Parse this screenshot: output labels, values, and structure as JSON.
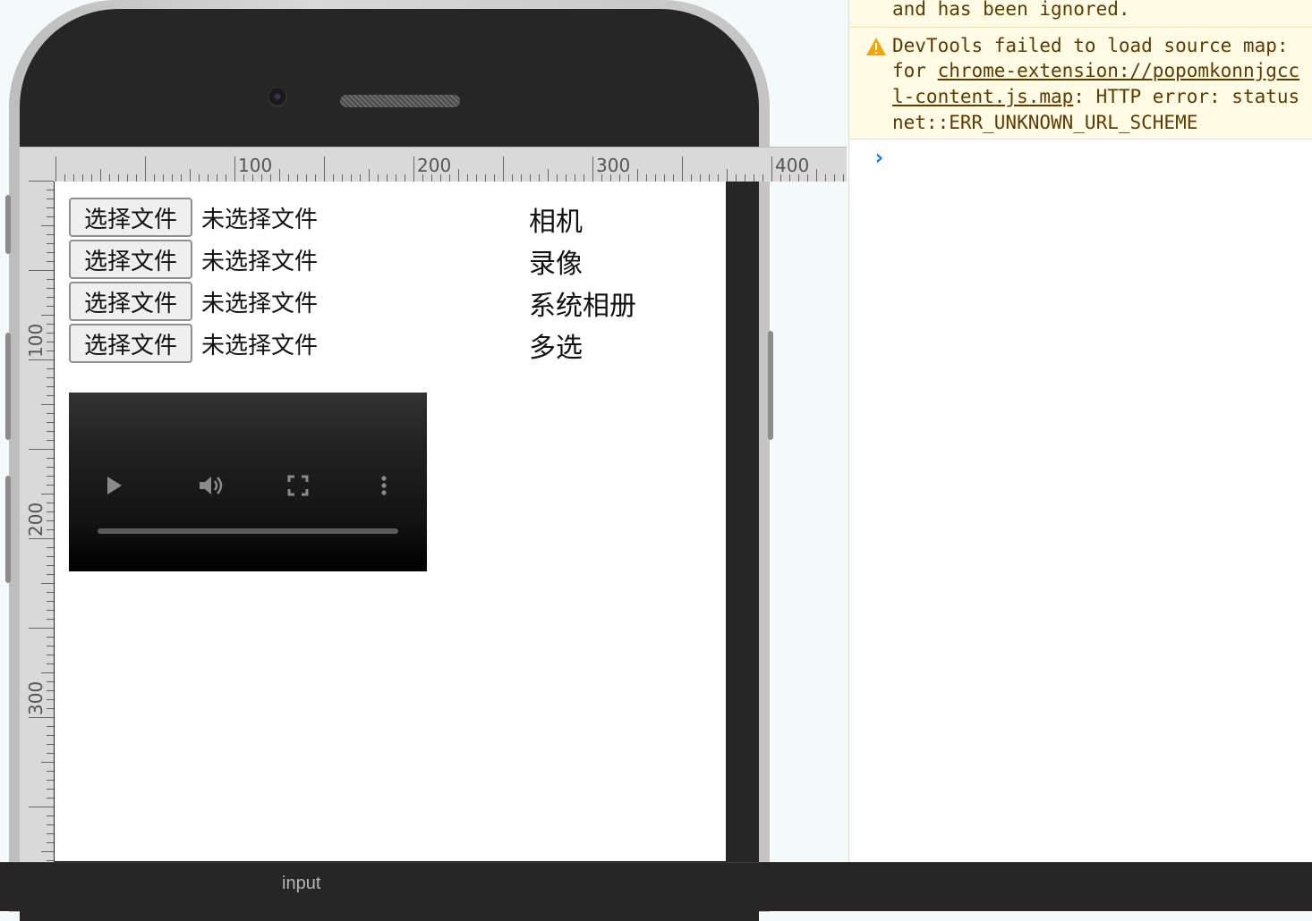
{
  "rulers": {
    "top_labels": [
      "100",
      "200",
      "300",
      "400"
    ],
    "left_labels": [
      "100",
      "200",
      "300"
    ]
  },
  "viewport": {
    "file_inputs": [
      {
        "button": "选择文件",
        "status": "未选择文件",
        "label": "相机"
      },
      {
        "button": "选择文件",
        "status": "未选择文件",
        "label": "录像"
      },
      {
        "button": "选择文件",
        "status": "未选择文件",
        "label": "系统相册"
      },
      {
        "button": "选择文件",
        "status": "未选择文件",
        "label": "多选"
      }
    ],
    "video": {
      "play_icon": "play-icon",
      "volume_icon": "volume-icon",
      "fullscreen_icon": "fullscreen-icon",
      "menu_icon": "more-vertical-icon"
    }
  },
  "console": {
    "lines_partial_top": "and has been ignored.",
    "warning": {
      "line1": "DevTools failed to load source map:",
      "line2_prefix": "for ",
      "line2_link": "chrome-extension://popomkonnjgcc",
      "line3_link": "l-content.js.map",
      "line3_suffix": ": HTTP error: status",
      "line4": "net::ERR_UNKNOWN_URL_SCHEME"
    },
    "prompt_symbol": "›"
  },
  "bottom_bar": {
    "label": "input"
  },
  "colors": {
    "warning_bg": "#fffbe5",
    "warning_text": "#5c3c00",
    "prompt_blue": "#1a73e8",
    "phone_body": "#262626"
  }
}
